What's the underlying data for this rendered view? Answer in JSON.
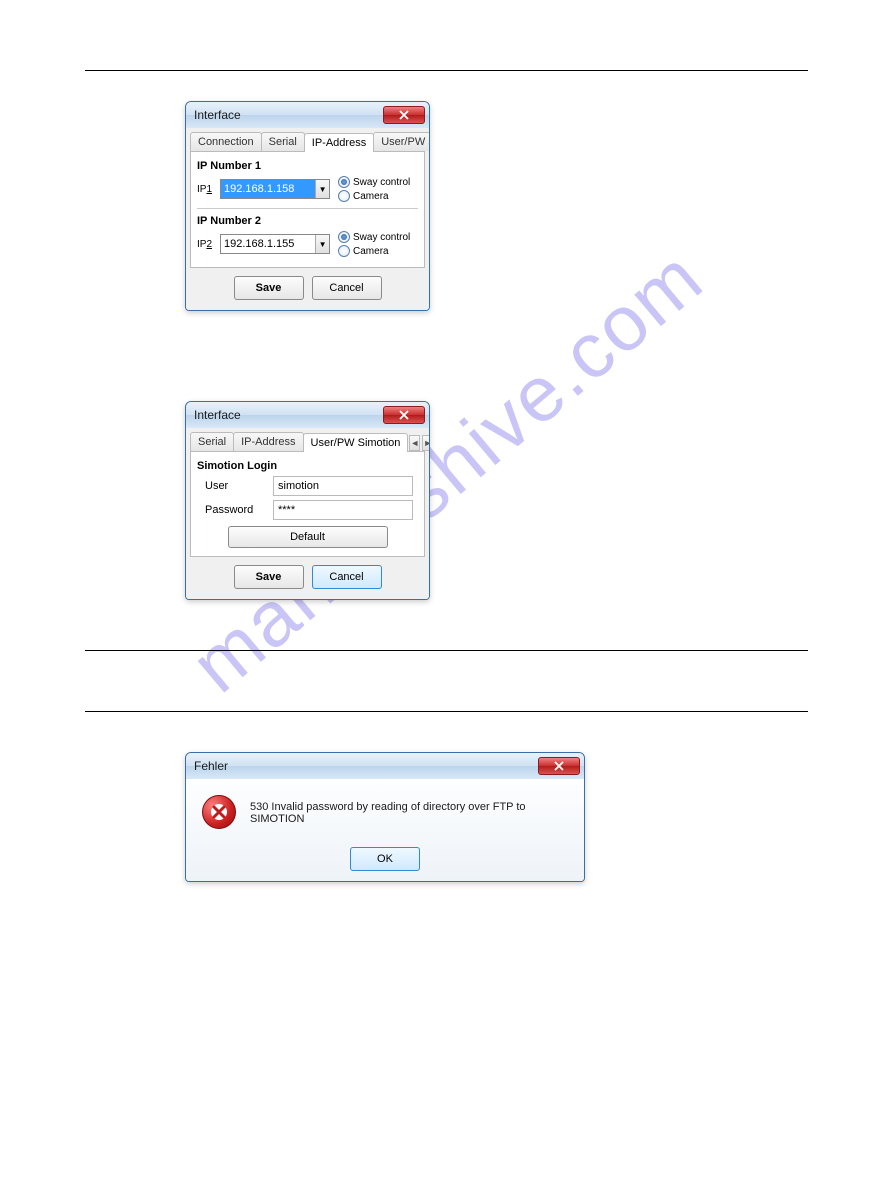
{
  "watermark": "manualshive.com",
  "interfaceDialog1": {
    "title": "Interface",
    "tabs": [
      "Connection",
      "Serial",
      "IP-Address",
      "User/PW Si"
    ],
    "activeTab": "IP-Address",
    "group1Label": "IP Number 1",
    "ip1Label": "IP",
    "ip1Num": "1",
    "ip1Value": "192.168.1.158",
    "radio1a": "Sway control",
    "radio1b": "Camera",
    "group2Label": "IP Number 2",
    "ip2Label": "IP",
    "ip2Num": "2",
    "ip2Value": "192.168.1.155",
    "radio2a": "Sway control",
    "radio2b": "Camera",
    "saveLabel": "Save",
    "cancelLabel": "Cancel"
  },
  "interfaceDialog2": {
    "title": "Interface",
    "tabs": [
      "Serial",
      "IP-Address",
      "User/PW Simotion"
    ],
    "activeTab": "User/PW Simotion",
    "groupLabel": "Simotion Login",
    "userLabel": "User",
    "userValue": "simotion",
    "pwLabel": "Password",
    "pwValue": "****",
    "defaultLabel": "Default",
    "saveLabel": "Save",
    "cancelLabel": "Cancel"
  },
  "errorDialog": {
    "title": "Fehler",
    "message": "530 Invalid password by reading of directory over FTP to SIMOTION",
    "okLabel": "OK"
  }
}
